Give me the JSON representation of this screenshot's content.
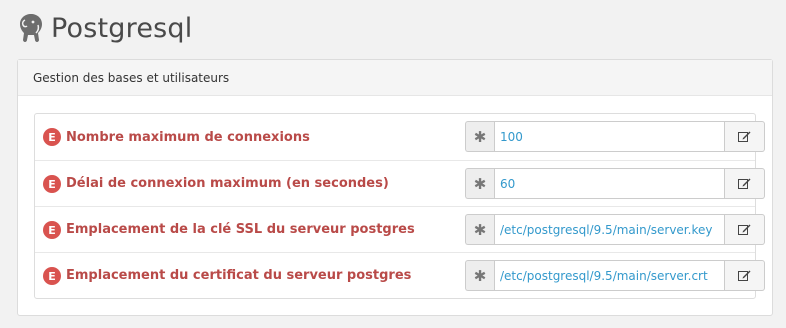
{
  "page": {
    "title": "Postgresql",
    "logo_icon": "elephant-icon"
  },
  "panel": {
    "heading": "Gestion des bases et utilisateurs"
  },
  "badge_letter": "E",
  "colors": {
    "label": "#b94a48",
    "badge": "#d9534f",
    "value": "#3399cc"
  },
  "settings": [
    {
      "label": "Nombre maximum de connexions",
      "value": "100",
      "addon_icon": "asterisk-icon",
      "button_icon": "edit-icon"
    },
    {
      "label": "Délai de connexion maximum (en secondes)",
      "value": "60",
      "addon_icon": "asterisk-icon",
      "button_icon": "edit-icon"
    },
    {
      "label": "Emplacement de la clé SSL du serveur postgres",
      "value": "/etc/postgresql/9.5/main/server.key",
      "addon_icon": "asterisk-icon",
      "button_icon": "edit-icon"
    },
    {
      "label": "Emplacement du certificat du serveur postgres",
      "value": "/etc/postgresql/9.5/main/server.crt",
      "addon_icon": "asterisk-icon",
      "button_icon": "edit-icon"
    }
  ]
}
